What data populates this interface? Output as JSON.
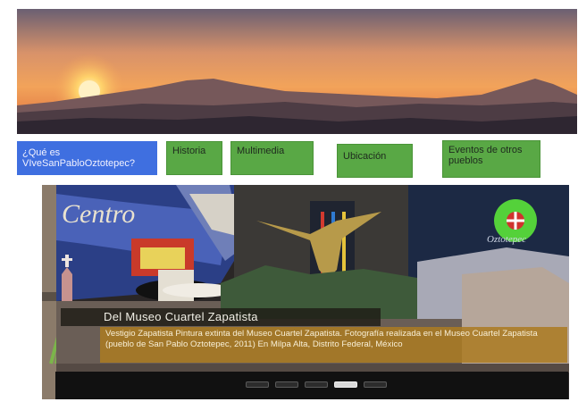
{
  "nav": {
    "items": [
      {
        "label": "¿Qué es VIveSanPabloOztotepec?"
      },
      {
        "label": "Historia"
      },
      {
        "label": "Multimedia"
      },
      {
        "label": "Ubicación"
      },
      {
        "label": "Eventos de otros pueblos"
      }
    ]
  },
  "slider": {
    "banner_text": "Centro",
    "logo_ring_text": "Oztotepec",
    "caption_title": "Del Museo Cuartel Zapatista",
    "caption_text": "Vestigio Zapatista Pintura extinta del Museo Cuartel Zapatista. Fotografía realizada en el Museo Cuartel Zapatista (pueblo de San Pablo Oztotepec, 2011) En Milpa Alta, Distrito Federal, México",
    "slide_count": 5,
    "active_slide": 4
  },
  "colors": {
    "nav_primary": "#3f6fe0",
    "nav_secondary": "#59a845",
    "caption_bg": "#ab7b22"
  }
}
